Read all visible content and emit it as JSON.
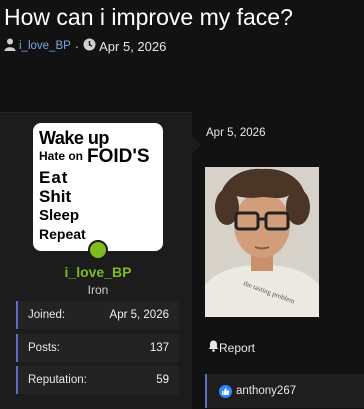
{
  "thread": {
    "title": "How can i improve my face?",
    "author": "i_love_BP",
    "date": "Apr 5, 2026"
  },
  "sidebar": {
    "avatar_text": [
      "Wake up",
      "Hate on",
      "FOID'S",
      "Eat",
      "Shit",
      "Sleep",
      "Repeat"
    ],
    "username": "i_love_BP",
    "rank": "Iron",
    "stats": [
      {
        "label": "Joined:",
        "value": "Apr 5, 2026"
      },
      {
        "label": "Posts:",
        "value": "137"
      },
      {
        "label": "Reputation:",
        "value": "59"
      }
    ]
  },
  "post": {
    "date": "Apr 5, 2026",
    "photo_shirt_text": "the tasting problem",
    "report_label": "Report",
    "reaction_user": "anthony267"
  },
  "colors": {
    "background": "#121212",
    "username_green": "#7fba1f",
    "link_blue": "#7aa7e6",
    "accent_bar": "#5b6ec0",
    "like_blue": "#2d88ff"
  }
}
